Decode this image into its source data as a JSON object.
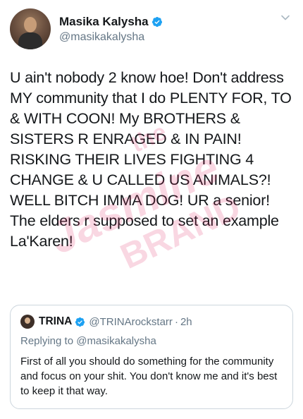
{
  "author": {
    "display_name": "Masika Kalysha",
    "handle": "@masikakalysha"
  },
  "tweet": {
    "text": "U ain't nobody 2 know hoe! Don't address MY community that I do PLENTY FOR, TO & WITH COON! My BROTHERS & SISTERS R ENRAGED & IN PAIN! RISKING THEIR LIVES FIGHTING 4 CHANGE & U CALLED US ANIMALS?! WELL BITCH IMMA DOG! UR a senior! The elders r supposed to set an example La'Karen!"
  },
  "watermark": {
    "line1": "the",
    "line2": "Jasmine",
    "line3": "BRAND"
  },
  "quoted_tweet": {
    "display_name": "TRINA",
    "handle": "@TRINArockstarr",
    "separator": "·",
    "time": "2h",
    "replying_to": "Replying to @masikakalysha",
    "text": "First of all you should do something for the community and focus on your shit. You don't know me and it's best to keep it that way."
  },
  "colors": {
    "verified": "#1da1f2",
    "secondary_text": "#657786",
    "watermark": "#e0245e"
  },
  "icons": {
    "verified": "verified-badge-icon",
    "more": "chevron-down-icon"
  }
}
